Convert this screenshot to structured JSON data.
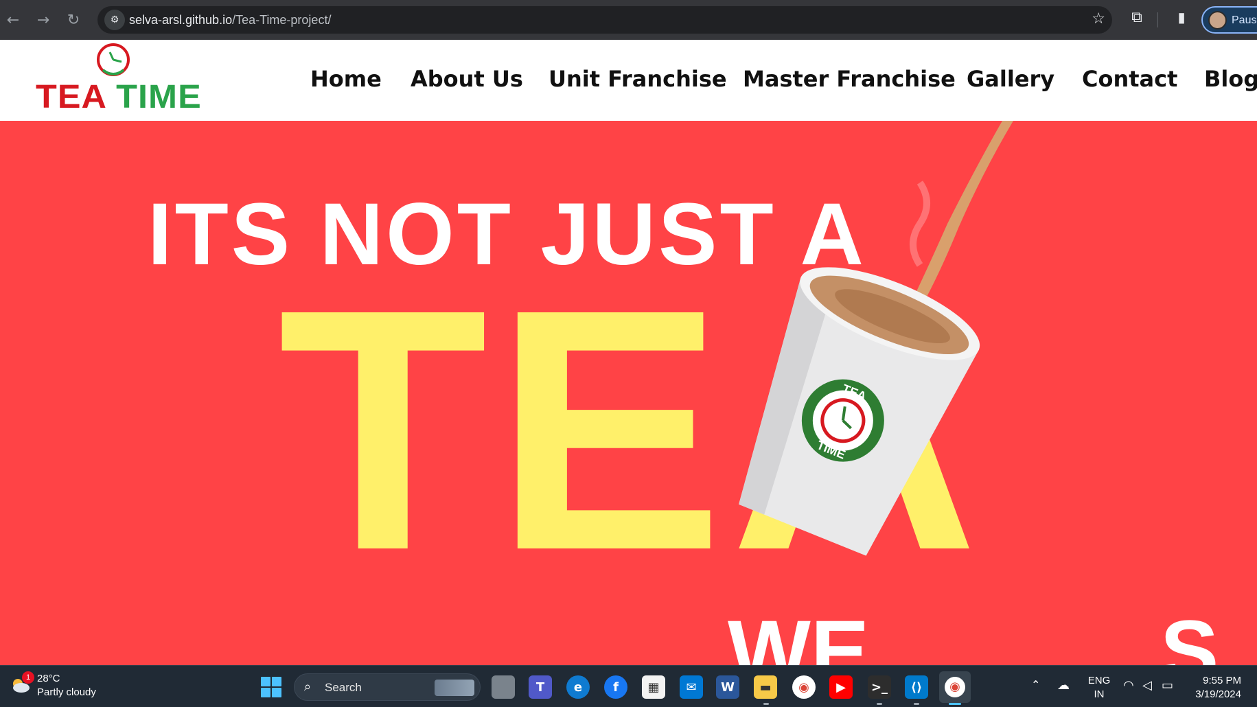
{
  "browser": {
    "back_icon": "arrow-left-icon",
    "forward_icon": "arrow-right-icon",
    "reload_icon": "reload-icon",
    "url_host": "selva-arsl.github.io",
    "url_path": "/Tea-Time-project/",
    "profile_label": "Pause"
  },
  "site": {
    "logo_tea": "TEA",
    "logo_time": "TIME",
    "nav": [
      "Home",
      "About Us",
      "Unit Franchise",
      "Master Franchise",
      "Gallery",
      "Contact",
      "Blog"
    ],
    "colors": {
      "red": "#ff4346",
      "yellow": "#fff06a",
      "logo_red": "#d71920",
      "logo_green": "#2aa34a"
    }
  },
  "hero": {
    "line1": "ITS NOT JUST A",
    "big_word": "TEA",
    "bottom_left": "WE",
    "bottom_right": "S",
    "cup_logo_top": "TEA",
    "cup_logo_bottom": "TIME"
  },
  "taskbar": {
    "weather_badge": "1",
    "weather_temp": "28°C",
    "weather_condition": "Partly cloudy",
    "search_label": "Search",
    "lang_line1": "ENG",
    "lang_line2": "IN",
    "time": "9:55 PM",
    "date": "3/19/2024"
  }
}
